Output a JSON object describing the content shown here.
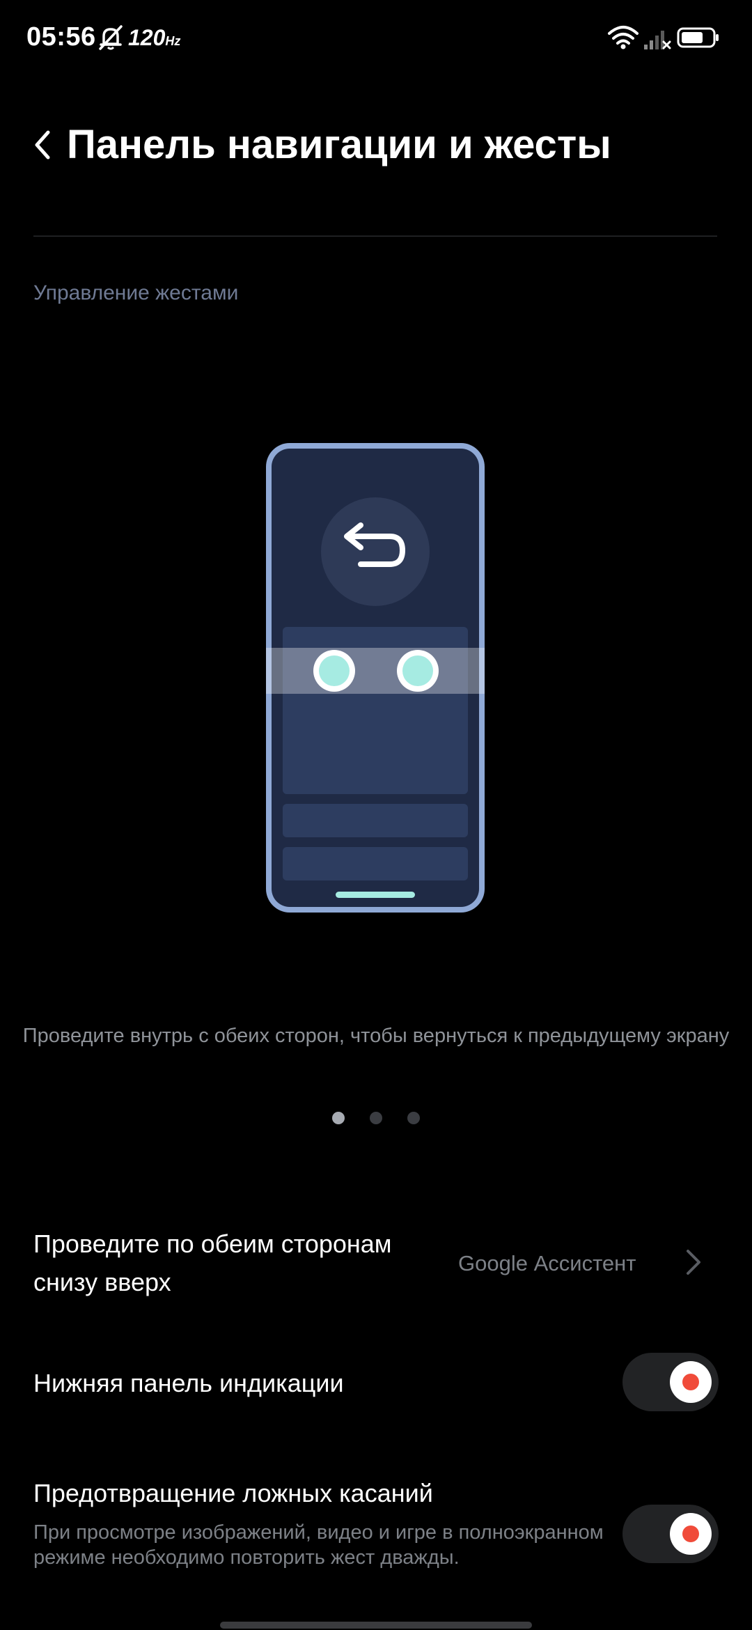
{
  "status_bar": {
    "time": "05:56",
    "refresh_rate": "120",
    "refresh_unit": "Hz",
    "icons": [
      "bell-off-icon",
      "wifi-icon",
      "signal-icon",
      "battery-icon"
    ]
  },
  "header": {
    "back_icon": "chevron-left-icon",
    "title": "Панель навигации и жесты"
  },
  "section": {
    "label": "Управление жестами"
  },
  "illustration": {
    "icon": "back-arrow-icon",
    "caption": "Проведите внутрь с обеих сторон, чтобы вернуться к предыдущему экрану",
    "pages_total": 3,
    "active_page": 1
  },
  "settings": {
    "swipe_up": {
      "title": "Проведите по обеим сторонам снизу вверх",
      "value": "Google Ассистент"
    },
    "bottom_bar": {
      "title": "Нижняя панель индикации",
      "enabled": true
    },
    "false_touch": {
      "title": "Предотвращение ложных касаний",
      "description": "При просмотре изображений, видео и игре в полноэкранном режиме необходимо повторить жест дважды.",
      "enabled": true
    }
  },
  "colors": {
    "background": "#000000",
    "accent_toggle": "#f04b3a",
    "phone_frame": "#8fa9d6",
    "phone_screen": "#1f2a45",
    "touch_dot": "#a6ebe2"
  }
}
